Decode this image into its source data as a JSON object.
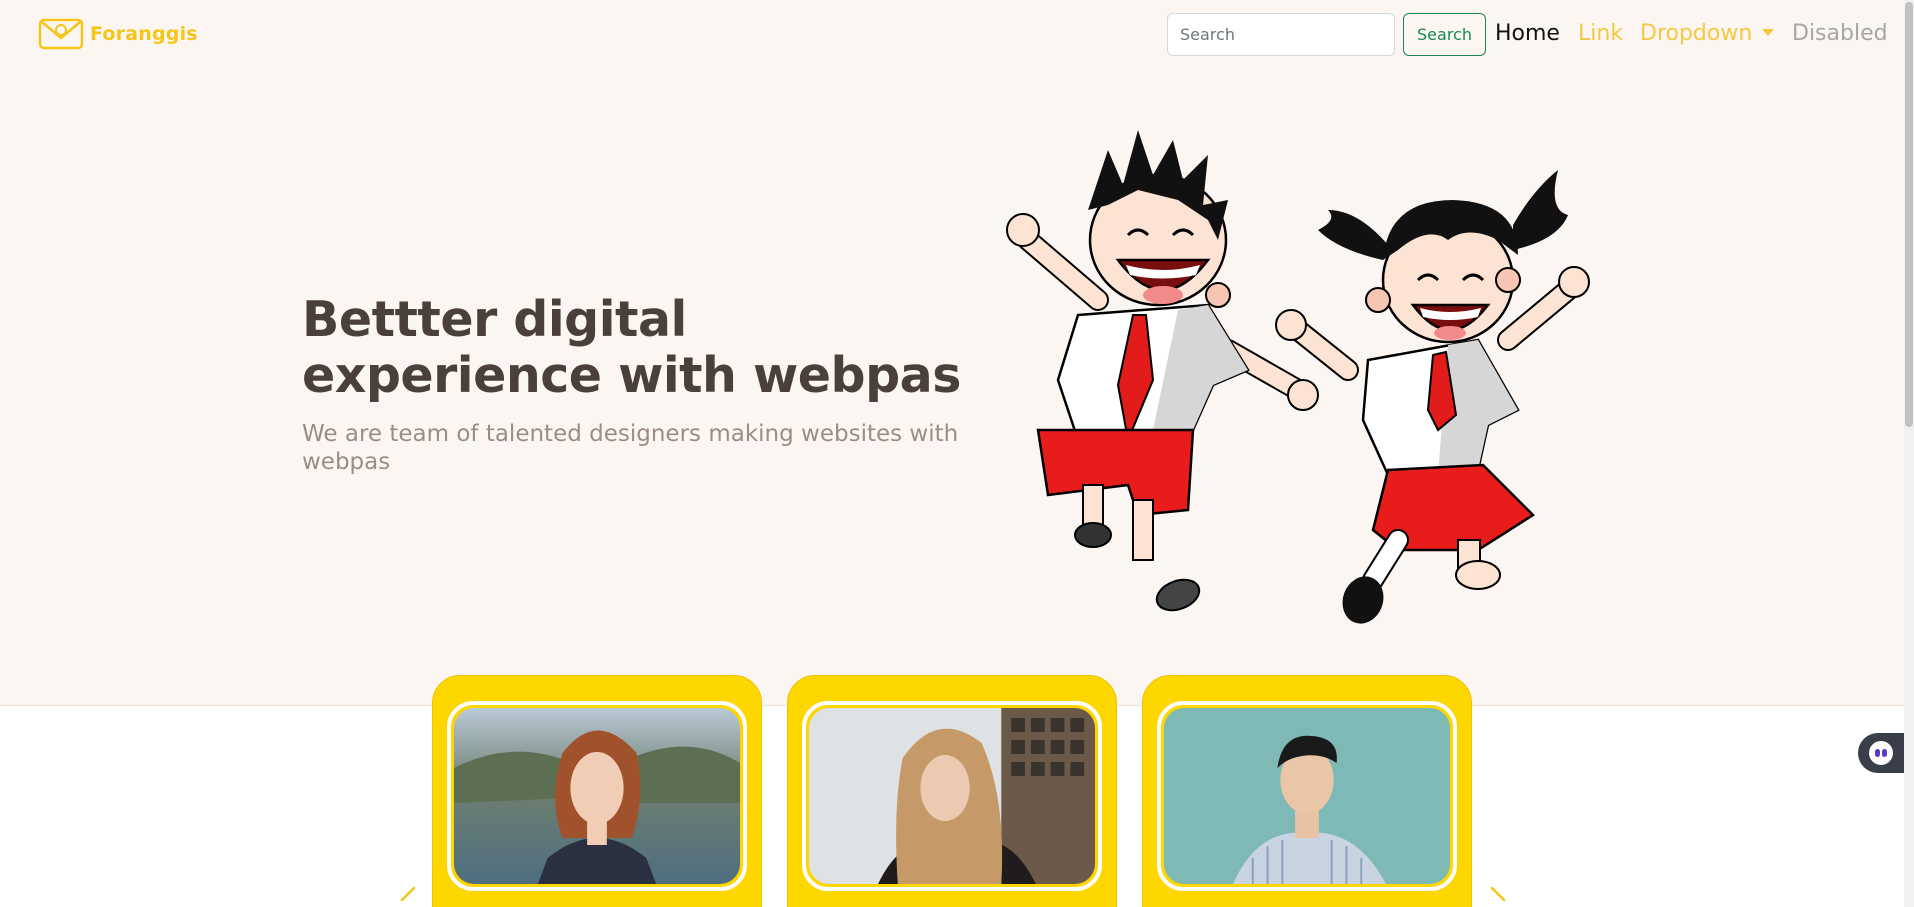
{
  "navbar": {
    "brand_name": "Foranggis",
    "search_placeholder": "Search",
    "search_button_label": "Search",
    "links": {
      "home": "Home",
      "link": "Link",
      "dropdown": "Dropdown",
      "disabled": "Disabled"
    }
  },
  "hero": {
    "title": "Bettter digital experience with webpas",
    "subtitle": "We are team of talented designers making websites with webpas",
    "illustration": "cartoon-kids-jumping"
  },
  "cards": [
    {
      "photo": "woman-short-red-hair-portrait"
    },
    {
      "photo": "woman-long-blonde-hair-portrait"
    },
    {
      "photo": "young-man-striped-shirt-portrait"
    }
  ],
  "colors": {
    "brand": "#f5c518",
    "card_bg": "#ffd700",
    "hero_bg": "#fcf6f3",
    "search_button": "#198754",
    "title_text": "#4a3f3a"
  }
}
